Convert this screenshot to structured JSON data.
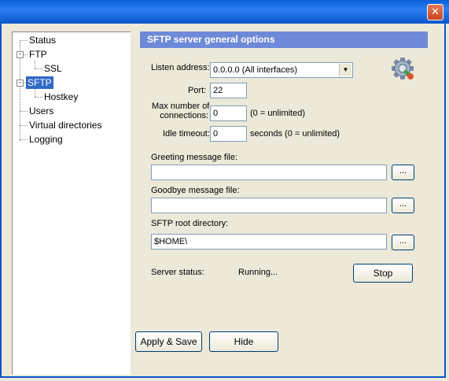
{
  "window": {
    "close_glyph": "✕"
  },
  "tree": {
    "items": [
      {
        "label": "Status"
      },
      {
        "label": "FTP"
      },
      {
        "label": "SSL"
      },
      {
        "label": "SFTP"
      },
      {
        "label": "Hostkey"
      },
      {
        "label": "Users"
      },
      {
        "label": "Virtual directories"
      },
      {
        "label": "Logging"
      }
    ],
    "expander_glyph": "-"
  },
  "panel": {
    "title": "SFTP server general options",
    "listen_address": {
      "label": "Listen address:",
      "value": "0.0.0.0 (All interfaces)",
      "arrow": "▼"
    },
    "port": {
      "label": "Port:",
      "value": "22"
    },
    "max_conn": {
      "label_line1": "Max number of",
      "label_line2": "connections:",
      "value": "0",
      "hint": "(0 = unlimited)"
    },
    "idle_timeout": {
      "label": "Idle timeout:",
      "value": "0",
      "hint": "seconds (0 = unlimited)"
    },
    "greeting": {
      "label": "Greeting message file:",
      "value": "",
      "browse": "..."
    },
    "goodbye": {
      "label": "Goodbye message file:",
      "value": "",
      "browse": "..."
    },
    "root_dir": {
      "label": "SFTP root directory:",
      "value": "$HOME\\",
      "browse": "..."
    },
    "status": {
      "label": "Server status:",
      "value": "Running...",
      "stop_button": "Stop"
    }
  },
  "footer": {
    "apply_save": "Apply & Save",
    "hide": "Hide"
  },
  "icons": {
    "settings": "gear-icon"
  }
}
